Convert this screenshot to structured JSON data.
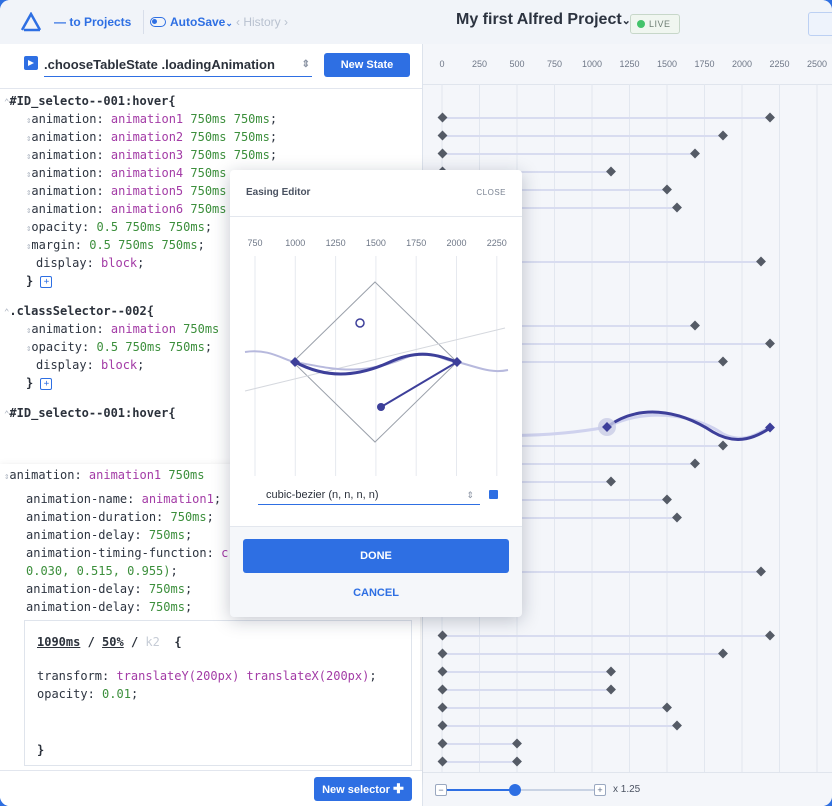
{
  "header": {
    "back_label": "— to Projects",
    "autosave_label": "AutoSave",
    "autosave_caret": "⌄",
    "history_label": "History",
    "history_prev": "‹",
    "history_next": "›",
    "project_title": "My first Alfred Project",
    "project_caret": "⌄",
    "live_label": "LIVE"
  },
  "state_bar": {
    "state_name": ".chooseTableState .loadingAnimation",
    "new_state_label": "New State"
  },
  "code": {
    "block1_selector": "#ID_selecto--001:hover{",
    "block1_lines": [
      {
        "prop": "animation: ",
        "val": "animation1",
        "num": " 750ms 750ms",
        "end": ";"
      },
      {
        "prop": "animation: ",
        "val": "animation2",
        "num": " 750ms 750ms",
        "end": ";"
      },
      {
        "prop": "animation: ",
        "val": "animation3",
        "num": " 750ms 750ms",
        "end": ";"
      },
      {
        "prop": "animation: ",
        "val": "animation4",
        "num": " 750ms",
        "end": ""
      },
      {
        "prop": "animation: ",
        "val": "animation5",
        "num": " 750ms",
        "end": ""
      },
      {
        "prop": "animation: ",
        "val": "animation6",
        "num": " 750ms",
        "end": ""
      },
      {
        "prop": "opacity: ",
        "val": "",
        "num": "0.5 750ms 750ms",
        "end": ";"
      },
      {
        "prop": "margin: ",
        "val": "",
        "num": "0.5 750ms 750ms",
        "end": ";"
      }
    ],
    "block1_display": "display: ",
    "block1_display_val": "block",
    "block2_selector": ".classSelector--002{",
    "block2_lines": [
      {
        "prop": "animation: ",
        "val": "animation",
        "num": " 750ms",
        "end": ""
      },
      {
        "prop": "opacity: ",
        "val": "",
        "num": "0.5 750ms 750ms",
        "end": ";"
      }
    ],
    "block2_display": "display: ",
    "block2_display_val": "block",
    "block3_selector_partial": "#ID_selecto--001:hover{",
    "close_brace": "}",
    "semicolon": ";",
    "bottom_lines": [
      {
        "prop": "opacity: ",
        "num": "0.5 750ms 750ms",
        "end": ";"
      },
      {
        "prop": "margin: ",
        "num": "0.5 750ms 750ms",
        "end": ";"
      }
    ]
  },
  "detail": {
    "header_prop": "animation: ",
    "header_val": "animation1",
    "header_num": " 750ms",
    "lines": [
      {
        "prop": "animation-name: ",
        "val": "animation1",
        "end": ";"
      },
      {
        "prop": "animation-duration: ",
        "num": "750ms",
        "end": ";"
      },
      {
        "prop": "animation-delay: ",
        "num": "750ms",
        "end": ";"
      },
      {
        "prop": "animation-timing-function: ",
        "val": "c",
        "end": ""
      },
      {
        "prop": "",
        "num": "0.030, 0.515, 0.955)",
        "end": ";"
      },
      {
        "prop": "animation-delay: ",
        "num": "750ms",
        "end": ";"
      },
      {
        "prop": "animation-delay: ",
        "num": "750ms",
        "end": ";"
      }
    ],
    "keyframe": {
      "time": "1090ms",
      "percent": "50%",
      "separator": "/",
      "muted": "k2",
      "brace": "{",
      "transform_prop": "transform: ",
      "transform_val": "translateY(200px) translateX(200px)",
      "opacity_prop": "opacity: ",
      "opacity_val": "0.01",
      "close": "}"
    }
  },
  "left_footer": {
    "new_selector_label": "New selector"
  },
  "timeline": {
    "ticks": [
      "0",
      "250",
      "500",
      "750",
      "1000",
      "1250",
      "1500",
      "1750",
      "2000",
      "2250",
      "2500"
    ],
    "zoom_label": "x 1.25",
    "zoom_minus": "−",
    "zoom_plus": "+",
    "zoom_value": 1.25
  },
  "easing_modal": {
    "title": "Easing Editor",
    "close_label": "CLOSE",
    "ticks": [
      "750",
      "1000",
      "1250",
      "1500",
      "1750",
      "2000",
      "2250"
    ],
    "curve_label": "cubic-bezier (n, n, n, n)",
    "done_label": "DONE",
    "cancel_label": "CANCEL"
  },
  "colors": {
    "accent": "#2e6fe3",
    "curve": "#3d3f9a",
    "keyframe": "#555b66",
    "live": "#43c36b"
  }
}
